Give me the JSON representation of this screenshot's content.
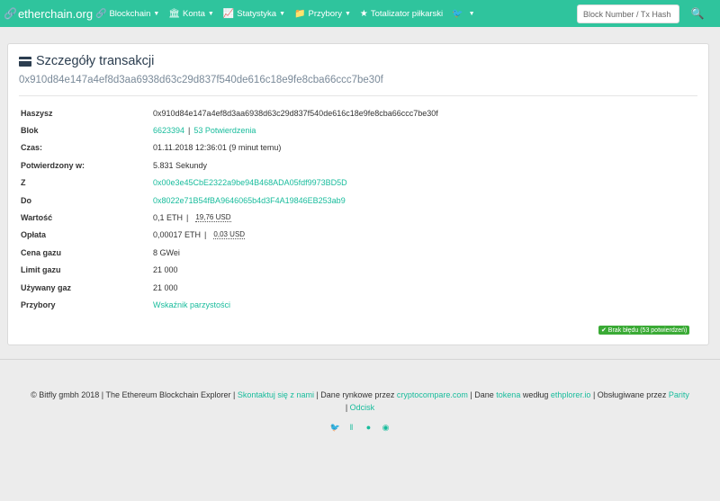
{
  "navbar": {
    "brand": "etherchain.org",
    "items": [
      {
        "label": "Blockchain",
        "icon": "link-icon"
      },
      {
        "label": "Konta",
        "icon": "bank-icon"
      },
      {
        "label": "Statystyka",
        "icon": "chart-icon"
      },
      {
        "label": "Przybory",
        "icon": "folder-icon"
      },
      {
        "label": "Totalizator piłkarski",
        "icon": "star-icon"
      }
    ],
    "search_placeholder": "Block Number / Tx Hash"
  },
  "panel": {
    "title": "Szczegóły transakcji",
    "tx_hash": "0x910d84e147a4ef8d3aa6938d63c29d837f540de616c18e9fe8cba66ccc7be30f"
  },
  "details": {
    "hash": {
      "label": "Haszysz",
      "value": "0x910d84e147a4ef8d3aa6938d63c29d837f540de616c18e9fe8cba66ccc7be30f"
    },
    "block": {
      "label": "Blok",
      "number": "6623394",
      "separator": "|",
      "confirmations": "53 Potwierdzenia"
    },
    "time": {
      "label": "Czas:",
      "value": "01.11.2018 12:36:01 (9 minut temu)"
    },
    "confirmed_in": {
      "label": "Potwierdzony w:",
      "value": "5.831 Sekundy"
    },
    "from": {
      "label": "Z",
      "value": "0x00e3e45CbE2322a9be94B468ADA05fdf9973BD5D"
    },
    "to": {
      "label": "Do",
      "value": "0x8022e71B54fBA9646065b4d3F4A19846EB253ab9"
    },
    "value": {
      "label": "Wartość",
      "eth": "0,1 ETH",
      "separator": "|",
      "usd": "19,76 USD"
    },
    "fee": {
      "label": "Opłata",
      "eth": "0,00017 ETH",
      "separator": "|",
      "usd": "0,03 USD"
    },
    "gas_price": {
      "label": "Cena gazu",
      "value": "8 GWei"
    },
    "gas_limit": {
      "label": "Limit gazu",
      "value": "21 000"
    },
    "gas_used": {
      "label": "Używany gaz",
      "value": "21 000"
    },
    "tools": {
      "label": "Przybory",
      "value": "Wskaźnik parzystości"
    }
  },
  "status_badge": "✔ Brak błędu (53 potwierdzeń)",
  "footer": {
    "text1": "© Bitfly gmbh 2018 | The Ethereum Blockchain Explorer |",
    "contact": "Skontaktuj się z nami",
    "text2": "| Dane rynkowe przez",
    "cryptocompare": "cryptocompare.com",
    "text3": "| Dane",
    "token": "tokena",
    "text4": "według",
    "ethplorer": "ethplorer.io",
    "text5": "| Obsługiwane przez",
    "parity": "Parity",
    "text6": "|",
    "odcisk": "Odcisk"
  },
  "colors": {
    "accent": "#2fc49d",
    "link": "#18bc9c",
    "badge": "#3aaa35"
  }
}
